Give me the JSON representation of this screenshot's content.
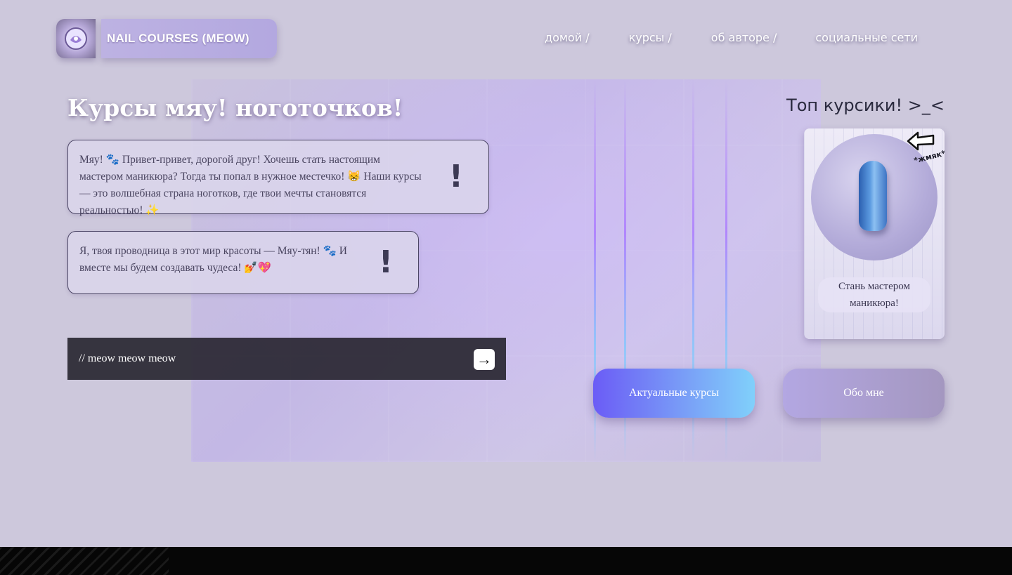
{
  "header": {
    "brand": "NAIL COURSES (MEOW)",
    "logo_icon": "nail-polish-logo-icon",
    "nav": [
      {
        "label": "домой /"
      },
      {
        "label": "курсы /"
      },
      {
        "label": "об авторе /"
      },
      {
        "label": "социальные сети"
      }
    ]
  },
  "hero": {
    "title": "Курсы мяу! ноготочков!",
    "bubble1": "Мяу! 🐾 Привет-привет, дорогой друг! Хочешь стать настоящим мастером маникюра? Тогда ты попал в нужное местечко! 😸 Наши курсы — это волшебная страна ноготков, где твои мечты становятся реальностью! ✨",
    "bubble2": "Я, твоя проводница в этот мир красоты — Мяу-тян! 🐾 И вместе мы будем создавать чудеса! 💅💖",
    "exclaim": "!",
    "meow_bar": "// meow meow meow",
    "meow_arrow": "→"
  },
  "top": {
    "title": "Топ курсики! >_<",
    "card_tag": "*жмяк*",
    "card_label": "Стань мастером маникюра!"
  },
  "buttons": {
    "courses": "Актуальные курсы",
    "about": "Обо мне"
  },
  "colors": {
    "background": "#cdc8dc",
    "accent_start": "#6b5cf6",
    "accent_end": "#80d0fb",
    "bubble_border": "#4b4565",
    "footer": "#060606"
  }
}
